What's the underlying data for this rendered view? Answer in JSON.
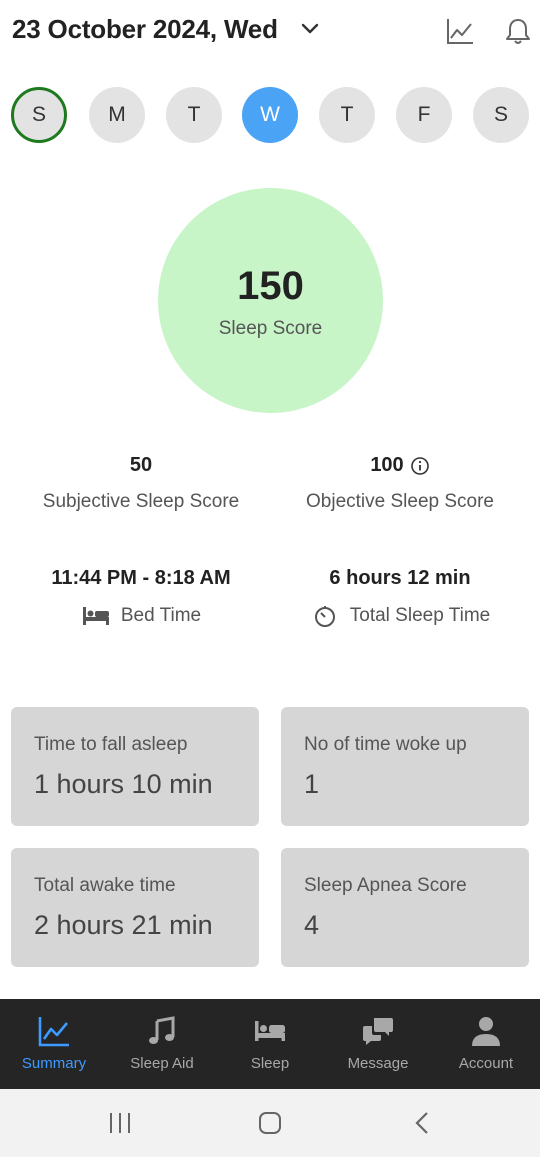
{
  "header": {
    "date_title": "23 October 2024, Wed",
    "icons": [
      "chevron-down-icon",
      "trend-chart-icon",
      "bell-icon"
    ]
  },
  "week": {
    "days": [
      "S",
      "M",
      "T",
      "W",
      "T",
      "F",
      "S"
    ],
    "selected_index": 3,
    "marked_index": 0,
    "colors": {
      "selected": "#4aa3f5",
      "marked_ring": "#1f7a1f",
      "default": "#e3e3e3"
    }
  },
  "score": {
    "value": "150",
    "label": "Sleep Score",
    "circle_color": "#c8f5c8"
  },
  "stats": {
    "subjective": {
      "value": "50",
      "label": "Subjective Sleep Score"
    },
    "objective": {
      "value": "100",
      "label": "Objective Sleep Score",
      "icon": "info-icon"
    },
    "bed_time": {
      "value": "11:44 PM - 8:18 AM",
      "label": "Bed Time",
      "icon": "bed-icon"
    },
    "total_sleep": {
      "value": "6 hours 12 min",
      "label": "Total Sleep Time",
      "icon": "timer-icon"
    }
  },
  "cards": [
    {
      "label": "Time to fall asleep",
      "value": "1 hours 10 min"
    },
    {
      "label": "No of time woke up",
      "value": "1"
    },
    {
      "label": "Total awake time",
      "value": "2 hours 21 min"
    },
    {
      "label": "Sleep Apnea Score",
      "value": "4"
    }
  ],
  "nav": {
    "items": [
      {
        "label": "Summary",
        "icon": "chart-icon",
        "active": true
      },
      {
        "label": "Sleep Aid",
        "icon": "music-note-icon",
        "active": false
      },
      {
        "label": "Sleep",
        "icon": "bed-icon",
        "active": false
      },
      {
        "label": "Message",
        "icon": "chat-icon",
        "active": false
      },
      {
        "label": "Account",
        "icon": "person-icon",
        "active": false
      }
    ],
    "colors": {
      "active": "#3d9bff",
      "inactive": "#a8a8a8",
      "background": "#252525"
    }
  },
  "system_bar": {
    "buttons": [
      "recent-apps-icon",
      "home-icon",
      "back-icon"
    ]
  }
}
